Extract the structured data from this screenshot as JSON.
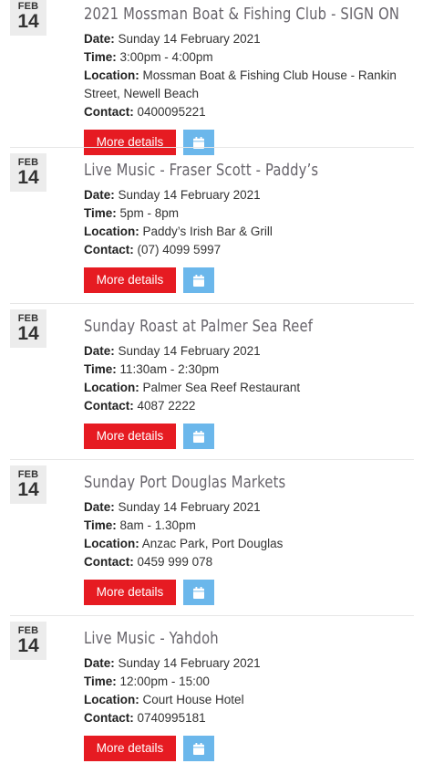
{
  "labels": {
    "date": "Date:",
    "time": "Time:",
    "location": "Location:",
    "contact": "Contact:",
    "more_details": "More details"
  },
  "events": [
    {
      "month": "FEB",
      "day": "14",
      "title": "2021 Mossman Boat & Fishing Club - SIGN ON",
      "date": "Sunday 14 February 2021",
      "time": "3:00pm - 4:00pm",
      "location": "Mossman Boat & Fishing Club House - Rankin Street, Newell Beach",
      "contact": "0400095221"
    },
    {
      "month": "FEB",
      "day": "14",
      "title": "Live Music - Fraser Scott - Paddy’s",
      "date": "Sunday 14 February 2021",
      "time": "5pm - 8pm",
      "location": "Paddy’s Irish Bar & Grill",
      "contact": "(07) 4099 5997"
    },
    {
      "month": "FEB",
      "day": "14",
      "title": "Sunday Roast at Palmer Sea Reef",
      "date": "Sunday 14 February 2021",
      "time": "11:30am - 2:30pm",
      "location": "Palmer Sea Reef Restaurant",
      "contact": "4087 2222"
    },
    {
      "month": "FEB",
      "day": "14",
      "title": "Sunday Port Douglas Markets",
      "date": "Sunday 14 February 2021",
      "time": "8am - 1.30pm",
      "location": "Anzac Park, Port Douglas",
      "contact": "0459 999 078"
    },
    {
      "month": "FEB",
      "day": "14",
      "title": "Live Music - Yahdoh",
      "date": "Sunday 14 February 2021",
      "time": "12:00pm - 15:00",
      "location": "Court House Hotel",
      "contact": "0740995181"
    }
  ],
  "colors": {
    "more_button": "#e61b22",
    "calendar_button": "#6bb7eb",
    "date_badge": "#ececec",
    "title": "#67646b"
  },
  "icons": {
    "calendar": "calendar-icon"
  }
}
